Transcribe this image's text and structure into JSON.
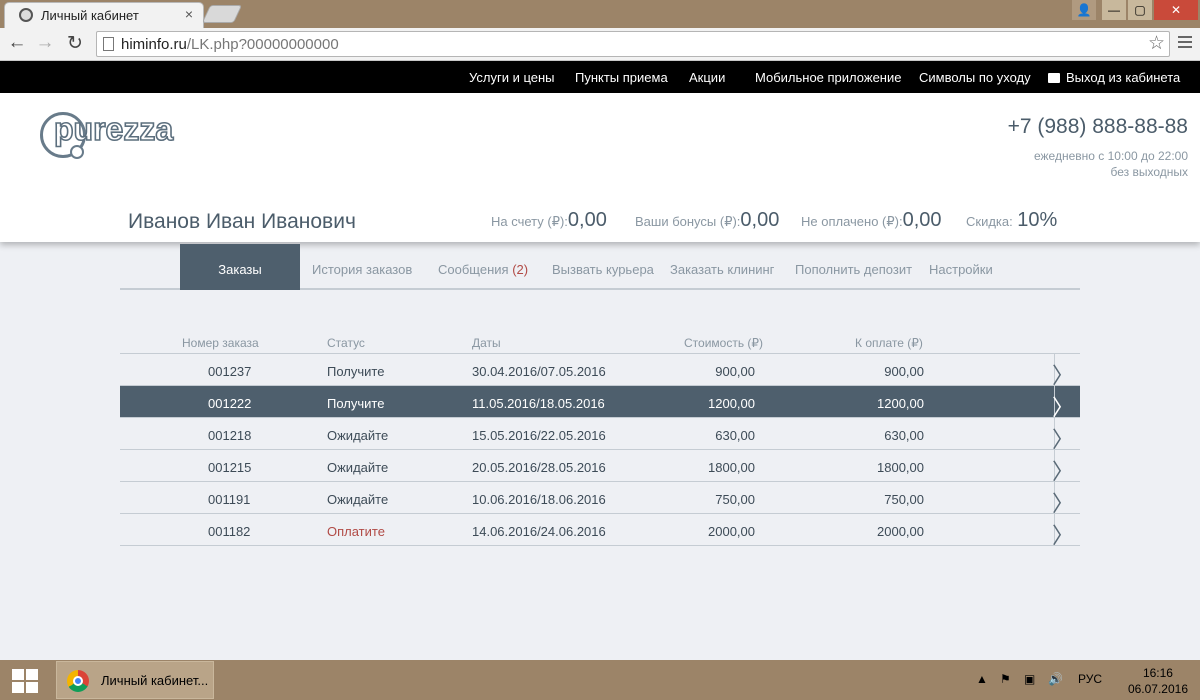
{
  "browser": {
    "tab_title": "Личный кабинет",
    "tab_close": "×",
    "url_host": "himinfo.ru",
    "url_path": "/LK.php?00000000000",
    "star": "☆",
    "win_user": "👤",
    "win_min": "—",
    "win_max": "▢",
    "win_close": "✕"
  },
  "site_nav": {
    "items": [
      "Услуги и цены",
      "Пункты приема",
      "Акции",
      "Мобильное приложение",
      "Символы по уходу"
    ],
    "logout": "Выход из кабинета"
  },
  "header": {
    "logo_text": "purezza",
    "phone": "+7 (988) 888-88-88",
    "hours_line1": "ежедневно с 10:00 до 22:00",
    "hours_line2": "без выходных",
    "username": "Иванов Иван Иванович",
    "stats": [
      {
        "label": "На счету (₽):",
        "value": "0,00"
      },
      {
        "label": "Ваши бонусы (₽):",
        "value": "0,00"
      },
      {
        "label": "Не оплачено (₽):",
        "value": "0,00"
      },
      {
        "label": "Скидка:",
        "value": "10%"
      }
    ]
  },
  "tabs": {
    "orders": "Заказы",
    "history": "История заказов",
    "messages": "Сообщения",
    "messages_count": "(2)",
    "courier": "Вызвать курьера",
    "cleaning": "Заказать клининг",
    "deposit": "Пополнить депозит",
    "settings": "Настройки"
  },
  "orders": {
    "columns": {
      "number": "Номер заказа",
      "status": "Статус",
      "dates": "Даты",
      "cost": "Стоимость (₽)",
      "due": "К оплате (₽)"
    },
    "rows": [
      {
        "number": "001237",
        "status": "Получите",
        "dates": "30.04.2016/07.05.2016",
        "cost": "900,00",
        "due": "900,00"
      },
      {
        "number": "001222",
        "status": "Получите",
        "dates": "11.05.2016/18.05.2016",
        "cost": "1200,00",
        "due": "1200,00"
      },
      {
        "number": "001218",
        "status": "Ожидайте",
        "dates": "15.05.2016/22.05.2016",
        "cost": "630,00",
        "due": "630,00"
      },
      {
        "number": "001215",
        "status": "Ожидайте",
        "dates": "20.05.2016/28.05.2016",
        "cost": "1800,00",
        "due": "1800,00"
      },
      {
        "number": "001191",
        "status": "Ожидайте",
        "dates": "10.06.2016/18.06.2016",
        "cost": "750,00",
        "due": "750,00"
      },
      {
        "number": "001182",
        "status": "Оплатите",
        "dates": "14.06.2016/24.06.2016",
        "cost": "2000,00",
        "due": "2000,00"
      }
    ],
    "arrow": "〉"
  },
  "taskbar": {
    "task_label": "Личный кабинет...",
    "tray_up": "▲",
    "tray_flag": "⚑",
    "tray_net": "▣",
    "tray_sound": "🔊",
    "lang": "РУС",
    "time": "16:16",
    "date": "06.07.2016"
  },
  "colors": {
    "accent": "#4e5f6d",
    "alert": "#b14a45",
    "muted": "#8a97a2",
    "taskbar": "#9c8468"
  }
}
